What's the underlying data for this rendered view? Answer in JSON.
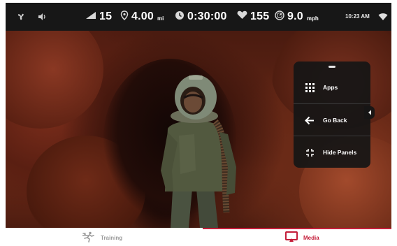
{
  "topbar": {
    "fan_icon": "fan-icon",
    "volume_icon": "speaker-icon",
    "incline": {
      "value": "15",
      "icon": "incline-icon"
    },
    "distance": {
      "value": "4.00",
      "unit": "mi",
      "icon": "location-pin-icon"
    },
    "elapsed": {
      "value": "0:30:00",
      "icon": "clock-icon"
    },
    "heart_rate": {
      "value": "155",
      "icon": "heart-icon"
    },
    "speed": {
      "value": "9.0",
      "unit": "mph",
      "icon": "speedometer-icon"
    },
    "clock": "10:23 AM",
    "wifi_icon": "wifi-icon"
  },
  "panel": {
    "items": [
      {
        "label": "Apps",
        "icon": "grid-icon"
      },
      {
        "label": "Go Back",
        "icon": "arrow-left-icon"
      },
      {
        "label": "Hide Panels",
        "icon": "collapse-icon"
      }
    ],
    "tab_icon": "chevron-left-icon"
  },
  "bottomnav": {
    "training": {
      "label": "Training",
      "icon": "runner-icon",
      "color": "#9a9a9a"
    },
    "media": {
      "label": "Media",
      "icon": "cast-screen-icon",
      "color": "#c41e3a"
    }
  },
  "colors": {
    "accent": "#c41e3a",
    "bar": "#171717",
    "panel": "#161616"
  }
}
